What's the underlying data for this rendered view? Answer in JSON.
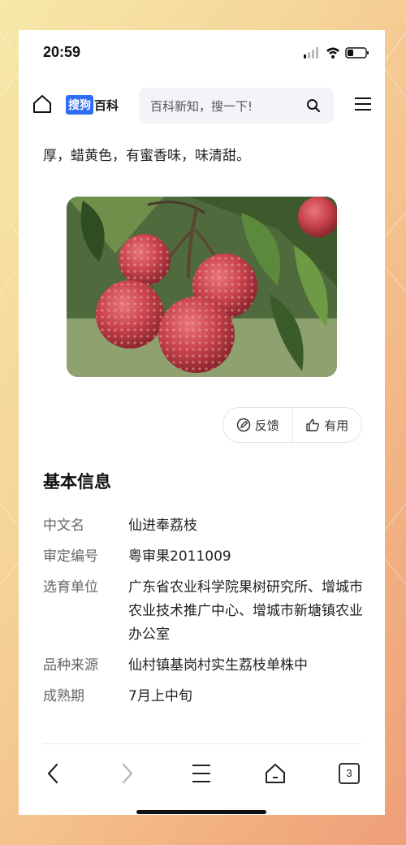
{
  "statusbar": {
    "time": "20:59"
  },
  "topnav": {
    "logo_badge": "搜狗",
    "logo_text": "百科",
    "search_placeholder": "百科新知，搜一下!"
  },
  "article": {
    "lead_text": "厚，蜡黄色，有蜜香味，味清甜。",
    "image_subject": "lychee-fruit-photo"
  },
  "feedback": {
    "feedback_label": "反馈",
    "useful_label": "有用"
  },
  "basic_info": {
    "title": "基本信息",
    "rows": [
      {
        "key": "中文名",
        "value": "仙进奉荔枝"
      },
      {
        "key": "审定编号",
        "value": "粤审果2011009"
      },
      {
        "key": "选育单位",
        "value": "广东省农业科学院果树研究所、增城市农业技术推广中心、增城市新塘镇农业办公室"
      },
      {
        "key": "品种来源",
        "value": "仙村镇基岗村实生荔枝单株中"
      },
      {
        "key": "成熟期",
        "value": "7月上中旬"
      }
    ]
  },
  "bottombar": {
    "tab_count": "3"
  },
  "colors": {
    "brand_blue": "#2f6df5",
    "text_dark": "#222222",
    "text_grey": "#666666"
  }
}
